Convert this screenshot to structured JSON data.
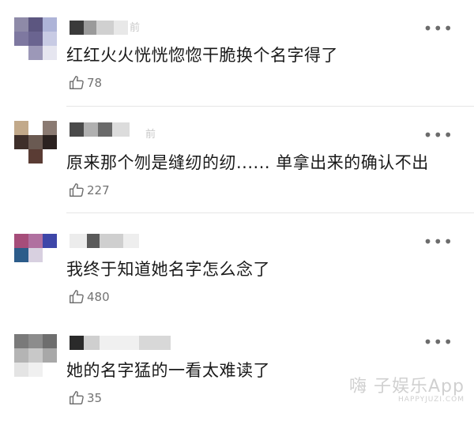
{
  "comments": [
    {
      "time_partial": "前",
      "text": "红红火火恍恍惚惚干脆换个名字得了",
      "likes": "78",
      "avatar_colors": [
        "#8e8aa8",
        "#5c5680",
        "#aeb4d8",
        "#7e78a0",
        "#6a6490",
        "#c8cbe4",
        "#ffffff",
        "#9c98b8",
        "#e6e6f0"
      ],
      "name_colors": [
        "#3a3a3a",
        "#9a9a9a",
        "#d0d0d0",
        "#e8e8e8"
      ]
    },
    {
      "time_partial": "前",
      "text": "原来那个刎是缝纫的纫...... 单拿出来的确认不出",
      "likes": "227",
      "avatar_colors": [
        "#c2a98a",
        "#ffffff",
        "#8a7a72",
        "#3e2f2a",
        "#6a5a52",
        "#2b2220",
        "#ffffff",
        "#5a3c34",
        "#ffffff"
      ],
      "name_colors": [
        "#4a4a4a",
        "#b0b0b0",
        "#6a6a6a",
        "#dcdcdc"
      ]
    },
    {
      "time_partial": "",
      "text": "我终于知道她名字怎么念了",
      "likes": "480",
      "avatar_colors": [
        "#a64d7a",
        "#b070a0",
        "#3e46a8",
        "#2c5c8a",
        "#d8d0e0",
        "#ffffff",
        "#ffffff",
        "#ffffff",
        "#ffffff"
      ],
      "name_colors": [
        "#ececec",
        "#5a5a5a",
        "#cfcfcf",
        "#eeeeee"
      ]
    },
    {
      "time_partial": "",
      "text": "她的名字猛的一看太难读了",
      "likes": "35",
      "avatar_colors": [
        "#7a7a7a",
        "#8c8c8c",
        "#6e6e6e",
        "#b4b4b4",
        "#c8c8c8",
        "#a8a8a8",
        "#e4e4e4",
        "#f0f0f0",
        "#ffffff"
      ],
      "name_colors": [
        "#2a2a2a",
        "#cfcfcf",
        "#f0f0f0",
        "#d8d8d8"
      ]
    }
  ],
  "more_label": "•••",
  "watermark": {
    "main": "嗨 子娱乐App",
    "sub": "HAPPYJUZI.COM"
  },
  "icons": {
    "like": "thumbs-up-icon",
    "more": "more-dots-icon"
  }
}
